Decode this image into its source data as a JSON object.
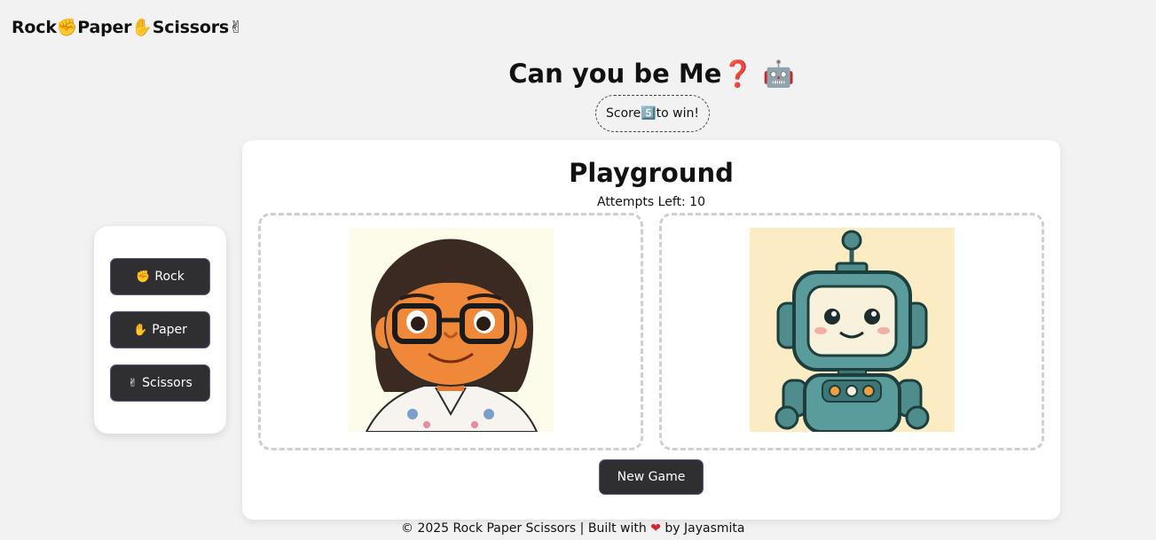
{
  "header": {
    "brand": "Rock✊Paper✋Scissors✌"
  },
  "hero": {
    "title": "Can you be Me❓ 🤖",
    "score_pill": "Score5️⃣to win!"
  },
  "controls": {
    "rock": {
      "emoji": "✊",
      "label": "Rock"
    },
    "paper": {
      "emoji": "✋",
      "label": "Paper"
    },
    "scissors": {
      "emoji": "✌",
      "label": "Scissors"
    }
  },
  "playground": {
    "title": "Playground",
    "attempts": "Attempts Left: 10",
    "new_game_label": "New Game"
  },
  "footer": {
    "text_before": "© 2025 Rock Paper Scissors | Built with",
    "heart": "❤",
    "text_after": "by Jayasmita"
  },
  "colors": {
    "background": "#f2f2f2",
    "button": "#2f2f31",
    "card": "#ffffff",
    "heart": "#d6202a",
    "robot": "#4f8c8c",
    "player_skin": "#f0883a"
  }
}
